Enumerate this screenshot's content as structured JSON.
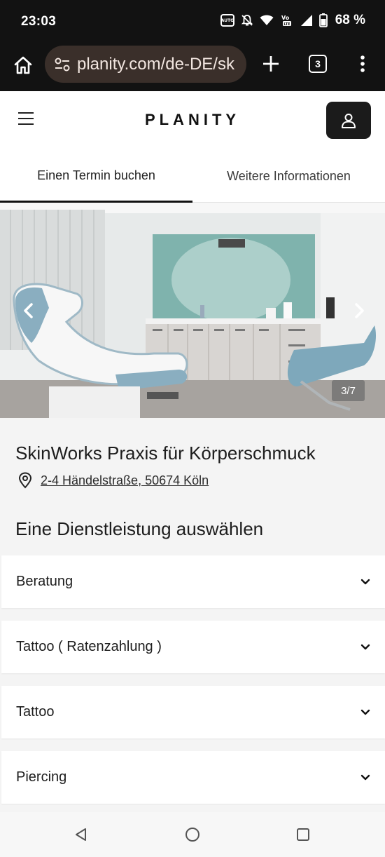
{
  "status_bar": {
    "time": "23:03",
    "battery_percent": "68 %",
    "icons": [
      "auto-brightness-icon",
      "bell-off-icon",
      "wifi-icon",
      "volte-icon",
      "signal-icon",
      "battery-icon"
    ]
  },
  "browser": {
    "url": "planity.com/de-DE/sk",
    "tab_count": "3",
    "icons": [
      "home-icon",
      "tune-icon",
      "plus-icon",
      "tabs-icon",
      "more-vert-icon"
    ]
  },
  "site": {
    "logo": "PLANITY",
    "tabs": [
      {
        "label": "Einen Termin buchen",
        "active": true
      },
      {
        "label": "Weitere Informationen",
        "active": false
      }
    ]
  },
  "carousel": {
    "counter": "3/7",
    "current": 3,
    "total": 7
  },
  "salon": {
    "name": "SkinWorks Praxis für Körperschmuck",
    "address": "2-4 Händelstraße, 50674 Köln"
  },
  "services": {
    "title": "Eine Dienstleistung auswählen",
    "items": [
      {
        "label": "Beratung"
      },
      {
        "label": "Tattoo ( Ratenzahlung )"
      },
      {
        "label": "Tattoo"
      },
      {
        "label": "Piercing"
      }
    ]
  },
  "colors": {
    "status_bar_bg": "#121212",
    "url_bar_bg": "#3a2f2a",
    "account_button_bg": "#1b1b1b",
    "page_bg": "#f4f4f4"
  }
}
